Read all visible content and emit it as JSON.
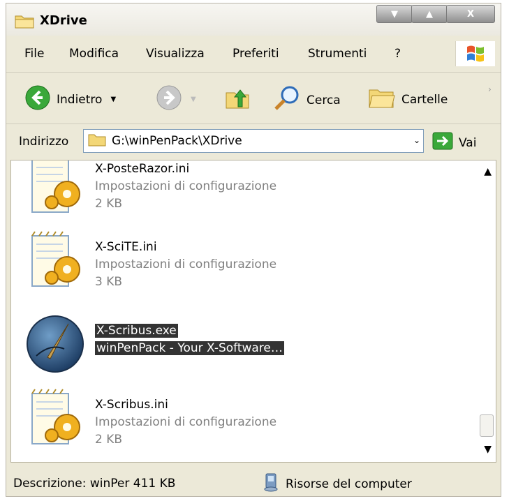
{
  "window": {
    "title": "XDrive"
  },
  "menu": [
    "File",
    "Modifica",
    "Visualizza",
    "Preferiti",
    "Strumenti",
    "?"
  ],
  "toolbar": {
    "back_label": "Indietro",
    "search_label": "Cerca",
    "folders_label": "Cartelle"
  },
  "address": {
    "label": "Indirizzo",
    "path": "G:\\winPenPack\\XDrive",
    "go_label": "Vai"
  },
  "files": [
    {
      "name": "X-PosteRazor.ini",
      "type": "Impostazioni di configurazione",
      "size": "2 KB",
      "icon": "config-file-icon",
      "selected": false
    },
    {
      "name": "X-SciTE.ini",
      "type": "Impostazioni di configurazione",
      "size": "3 KB",
      "icon": "config-file-icon",
      "selected": false
    },
    {
      "name": "X-Scribus.exe",
      "type": "winPenPack - Your X-Software…",
      "size": "",
      "icon": "scribus-app-icon",
      "selected": true
    },
    {
      "name": "X-Scribus.ini",
      "type": "Impostazioni di configurazione",
      "size": "2 KB",
      "icon": "config-file-icon",
      "selected": false
    }
  ],
  "status": {
    "description": "Descrizione: winPer 411 KB",
    "location": "Risorse del computer"
  }
}
